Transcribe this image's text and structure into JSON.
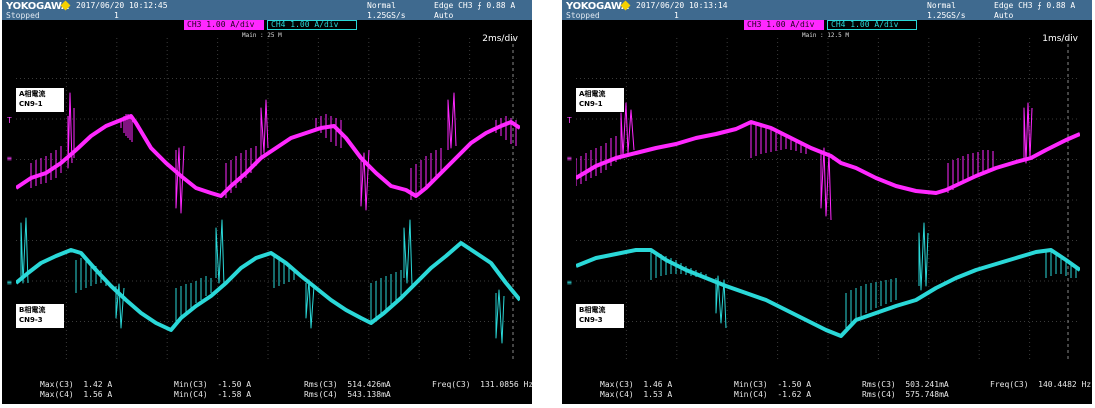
{
  "screenshots": [
    {
      "header": {
        "brand": "YOKOGAWA",
        "state": "Stopped",
        "timestamp": "2017/06/20 10:12:45",
        "acq_count": "1",
        "acq_mode": "Normal",
        "sample_rate": "1.25GS/s",
        "trigger": "Edge CH3 ⨍ 0.88 A",
        "trigger_mode": "Auto"
      },
      "ch3_box": "CH3  1.00 A/div",
      "ch4_box": "CH4  1.00 A/div",
      "main_memory": "Main : 25 M",
      "time_div": "2ms/div",
      "label_a": [
        "A相電流",
        "CN9-1"
      ],
      "label_b": [
        "B相電流",
        "CN9-3"
      ],
      "measurements": {
        "max_c3": "Max(C3)  1.42 A",
        "max_c4": "Max(C4)  1.56 A",
        "min_c3": "Min(C3)  -1.50 A",
        "min_c4": "Min(C4)  -1.58 A",
        "rms_c3": "Rms(C3)  514.426mA",
        "rms_c4": "Rms(C4)  543.138mA",
        "freq_c3": "Freq(C3)  131.0856 Hz"
      }
    },
    {
      "header": {
        "brand": "YOKOGAWA",
        "state": "Stopped",
        "timestamp": "2017/06/20 10:13:14",
        "acq_count": "1",
        "acq_mode": "Normal",
        "sample_rate": "1.25GS/s",
        "trigger": "Edge CH3 ⨍ 0.88 A",
        "trigger_mode": "Auto"
      },
      "ch3_box": "CH3  1.00 A/div",
      "ch4_box": "CH4  1.00 A/div",
      "main_memory": "Main : 12.5 M",
      "time_div": "1ms/div",
      "label_a": [
        "A相電流",
        "CN9-1"
      ],
      "label_b": [
        "B相電流",
        "CN9-3"
      ],
      "measurements": {
        "max_c3": "Max(C3)  1.46 A",
        "max_c4": "Max(C4)  1.53 A",
        "min_c3": "Min(C3)  -1.50 A",
        "min_c4": "Min(C4)  -1.62 A",
        "rms_c3": "Rms(C3)  503.241mA",
        "rms_c4": "Rms(C4)  575.748mA",
        "freq_c3": "Freq(C3)  140.4482 Hz"
      }
    }
  ],
  "colors": {
    "ch3": "#ff28ff",
    "ch4": "#2ad8d8",
    "header_bg": "#3f6a8f",
    "screen_bg": "#000000"
  }
}
